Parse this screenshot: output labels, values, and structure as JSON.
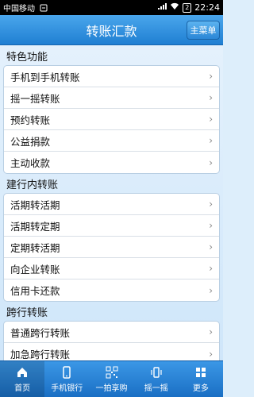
{
  "status_bar": {
    "carrier": "中国移动",
    "battery": "2",
    "time": "22:24"
  },
  "header": {
    "title": "转账汇款",
    "main_menu_label": "主菜单"
  },
  "sections": [
    {
      "title": "特色功能",
      "items": [
        "手机到手机转账",
        "摇一摇转账",
        "预约转账",
        "公益捐款",
        "主动收款"
      ]
    },
    {
      "title": "建行内转账",
      "items": [
        "活期转活期",
        "活期转定期",
        "定期转活期",
        "向企业转账",
        "信用卡还款"
      ]
    },
    {
      "title": "跨行转账",
      "items": [
        "普通跨行转账",
        "加急跨行转账"
      ]
    }
  ],
  "tabbar": {
    "items": [
      {
        "label": "首页",
        "icon": "home-icon"
      },
      {
        "label": "手机银行",
        "icon": "phone-icon"
      },
      {
        "label": "一拍享购",
        "icon": "qrcode-icon"
      },
      {
        "label": "摇一摇",
        "icon": "shake-icon"
      },
      {
        "label": "更多",
        "icon": "more-icon"
      }
    ]
  },
  "colors": {
    "accent": "#1f7fd2",
    "background": "#ddeefb"
  }
}
